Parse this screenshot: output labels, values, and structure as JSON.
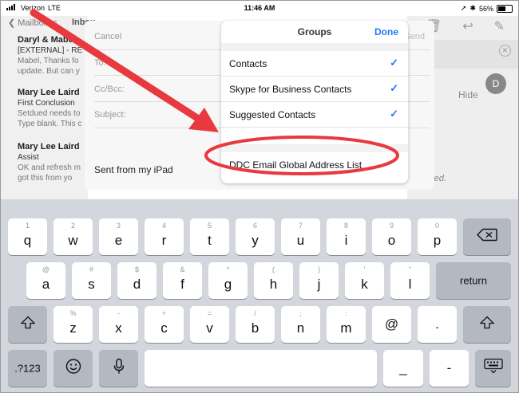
{
  "status_bar": {
    "carrier": "Verizon",
    "network": "LTE",
    "time": "11:46 AM",
    "battery": "56%"
  },
  "mail_nav": {
    "back_label": "Mailboxes",
    "inbox_label": "Inbox"
  },
  "mails": [
    {
      "sender": "Daryl & Mabel",
      "subject": "[EXTERNAL] - RE",
      "preview1": "Mabel, Thanks fo",
      "preview2": "update. But can y"
    },
    {
      "sender": "Mary Lee Laird",
      "subject": "First Conclusion",
      "preview1": "Setdued needs to",
      "preview2": "Type blank. This c"
    },
    {
      "sender": "Mary Lee Laird",
      "subject": "Assist",
      "preview1": "OK and refresh m",
      "preview2": "got this from yo"
    }
  ],
  "reading": {
    "hide_label": "Hide",
    "avatar_initial": "D",
    "tail_text": "red."
  },
  "compose": {
    "cancel_label": "Cancel",
    "to_label": "To:",
    "ccbcc_label": "Cc/Bcc:",
    "subject_label": "Subject:",
    "signature": "Sent from my iPad",
    "send_label": "Send"
  },
  "groups_popover": {
    "title": "Groups",
    "done_label": "Done",
    "items": [
      {
        "label": "Contacts",
        "checked": "✓"
      },
      {
        "label": "Skype for Business Contacts",
        "checked": "✓"
      },
      {
        "label": "Suggested Contacts",
        "checked": "✓"
      }
    ],
    "extra_item": "DDC Email Global Address List"
  },
  "keyboard": {
    "row1": [
      {
        "main": "q",
        "sub": "1"
      },
      {
        "main": "w",
        "sub": "2"
      },
      {
        "main": "e",
        "sub": "3"
      },
      {
        "main": "r",
        "sub": "4"
      },
      {
        "main": "t",
        "sub": "5"
      },
      {
        "main": "y",
        "sub": "6"
      },
      {
        "main": "u",
        "sub": "7"
      },
      {
        "main": "i",
        "sub": "8"
      },
      {
        "main": "o",
        "sub": "9"
      },
      {
        "main": "p",
        "sub": "0"
      }
    ],
    "row2": [
      {
        "main": "a",
        "sub": "@"
      },
      {
        "main": "s",
        "sub": "#"
      },
      {
        "main": "d",
        "sub": "$"
      },
      {
        "main": "f",
        "sub": "&"
      },
      {
        "main": "g",
        "sub": "*"
      },
      {
        "main": "h",
        "sub": "("
      },
      {
        "main": "j",
        "sub": ")"
      },
      {
        "main": "k",
        "sub": "'"
      },
      {
        "main": "l",
        "sub": "\""
      }
    ],
    "row3": [
      {
        "main": "z",
        "sub": "%"
      },
      {
        "main": "x",
        "sub": "-"
      },
      {
        "main": "c",
        "sub": "+"
      },
      {
        "main": "v",
        "sub": "="
      },
      {
        "main": "b",
        "sub": "/"
      },
      {
        "main": "n",
        "sub": ";"
      },
      {
        "main": "m",
        "sub": ":"
      },
      {
        "main": "@",
        "sub": ""
      },
      {
        "main": ".",
        "sub": ""
      }
    ],
    "return_label": "return",
    "numbers_label": ".?123",
    "underscore_label": "_",
    "dash_label": "-"
  },
  "annotation_color": "#e8393f"
}
